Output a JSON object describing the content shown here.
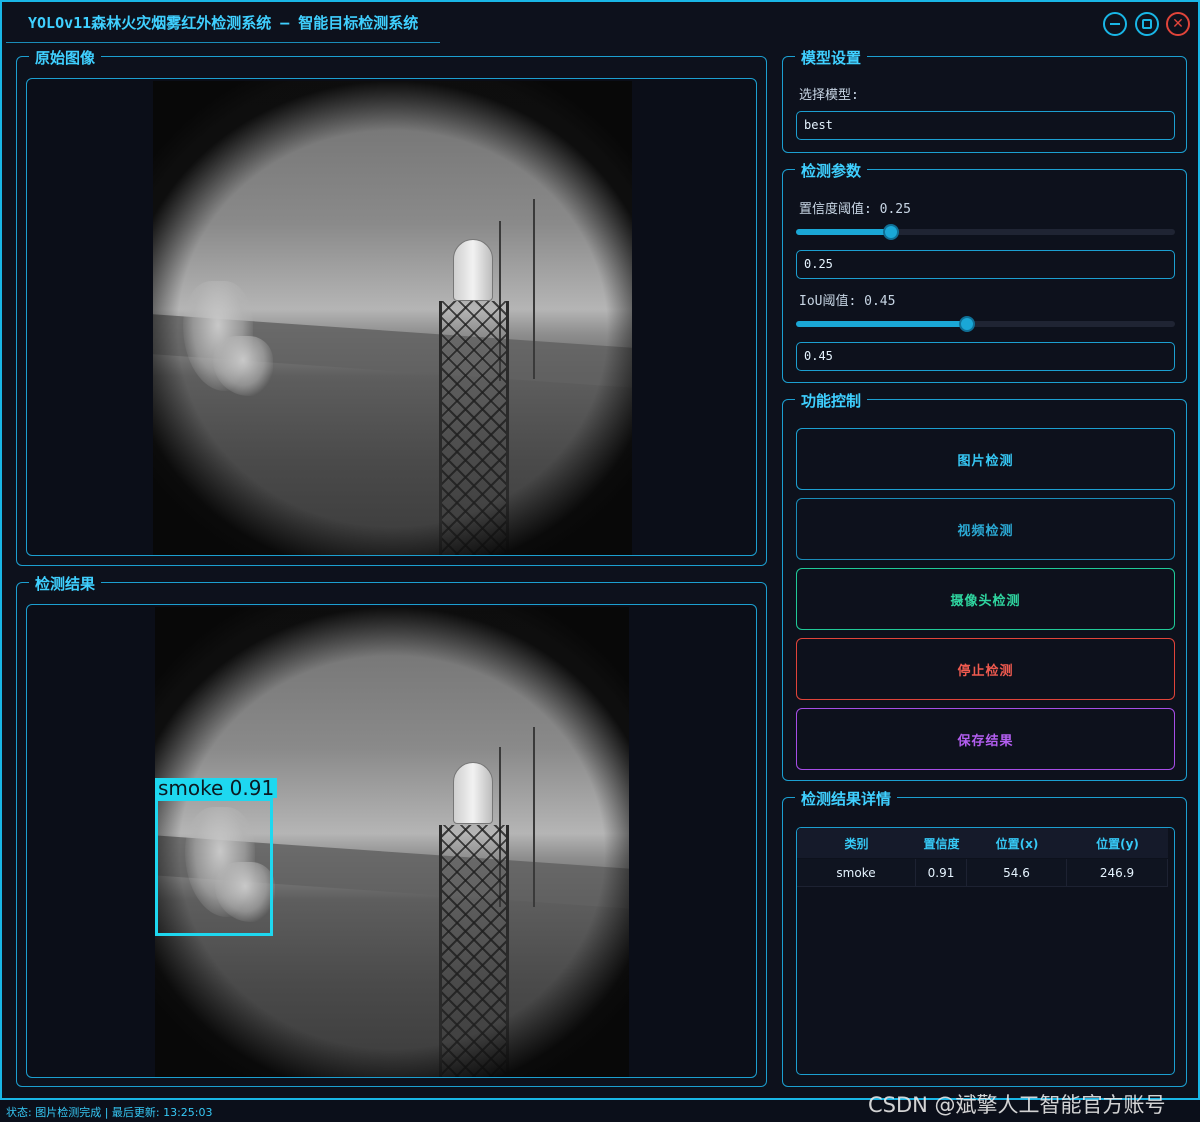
{
  "window": {
    "title": "YOLOv11森林火灾烟雾红外检测系统 – 智能目标检测系统"
  },
  "panels": {
    "original_title": "原始图像",
    "result_title": "检测结果",
    "model_title": "模型设置",
    "params_title": "检测参数",
    "control_title": "功能控制",
    "details_title": "检测结果详情"
  },
  "model": {
    "select_label": "选择模型:",
    "selected": "best"
  },
  "params": {
    "confidence_label": "置信度阈值: 0.25",
    "confidence_value": "0.25",
    "confidence_fraction": 0.25,
    "iou_label": "IoU阈值: 0.45",
    "iou_value": "0.45",
    "iou_fraction": 0.45
  },
  "controls": {
    "image_detect": "图片检测",
    "video_detect": "视频检测",
    "camera_detect": "摄像头检测",
    "stop_detect": "停止检测",
    "save_result": "保存结果"
  },
  "colors": {
    "accent": "#19b6e6",
    "image_btn": "#1c9fd0",
    "video_btn": "#1a8cb8",
    "camera_btn": "#20c997",
    "stop_btn": "#e0443a",
    "save_btn": "#a64de6",
    "bbox": "#1ed8f0"
  },
  "detection": {
    "label": "smoke 0.91"
  },
  "table": {
    "headers": [
      "类别",
      "置信度",
      "位置(x)",
      "位置(y)"
    ],
    "rows": [
      [
        "smoke",
        "0.91",
        "54.6",
        "246.9"
      ]
    ]
  },
  "status": {
    "text": "状态: 图片检测完成 | 最后更新: 13:25:03"
  },
  "watermark": "CSDN @斌擎人工智能官方账号"
}
